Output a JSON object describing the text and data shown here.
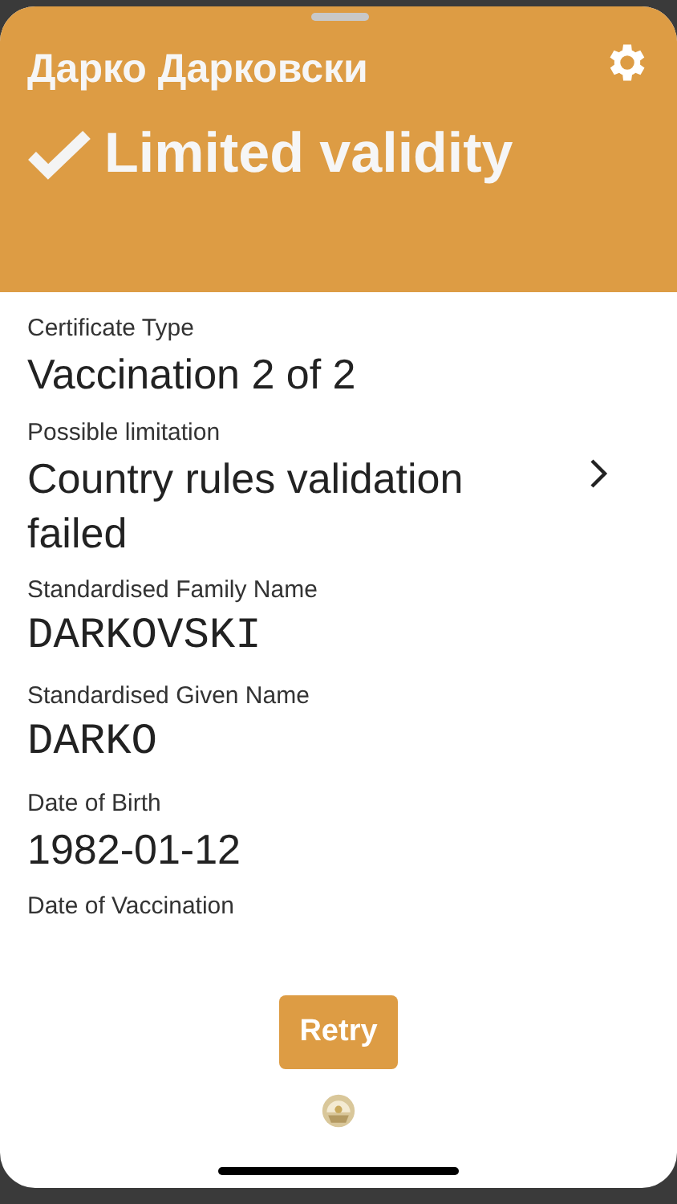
{
  "header": {
    "name": "Дарко Дарковски",
    "status": "Limited validity"
  },
  "fields": [
    {
      "label": "Certificate Type",
      "value": "Vaccination 2 of 2",
      "kind": "text"
    },
    {
      "label": "Possible limitation",
      "value": "Country rules validation failed",
      "kind": "link"
    },
    {
      "label": "Standardised Family Name",
      "value": "DARKOVSKI",
      "kind": "mono"
    },
    {
      "label": "Standardised Given Name",
      "value": "DARKO",
      "kind": "mono"
    },
    {
      "label": "Date of Birth",
      "value": "1982-01-12",
      "kind": "text"
    },
    {
      "label": "Date of Vaccination",
      "kind": "text"
    }
  ],
  "retry_button": "Retry"
}
